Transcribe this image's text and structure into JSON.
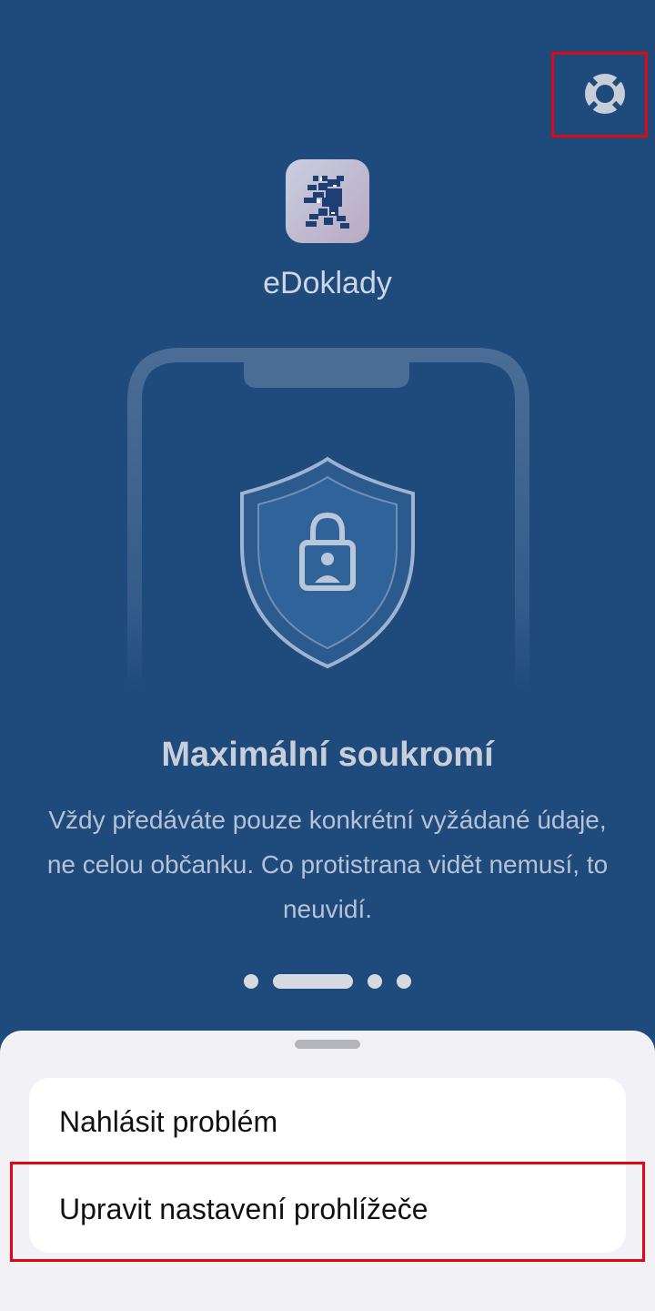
{
  "app": {
    "name": "eDoklady",
    "icon": "czech-lion-icon"
  },
  "header": {
    "help_icon": "lifebuoy-icon"
  },
  "onboarding": {
    "title": "Maximální soukromí",
    "description": "Vždy předáváte pouze konkrétní vyžádané údaje, ne celou občanku. Co protistrana vidět nemusí, to neuvidí.",
    "pages_total": 4,
    "current_page": 2
  },
  "sheet": {
    "items": [
      {
        "label": "Nahlásit problém"
      },
      {
        "label": "Upravit nastavení prohlížeče"
      }
    ]
  },
  "colors": {
    "background": "#1e4a7c",
    "sheet_background": "#f1f1f6",
    "highlight": "#e30613"
  }
}
